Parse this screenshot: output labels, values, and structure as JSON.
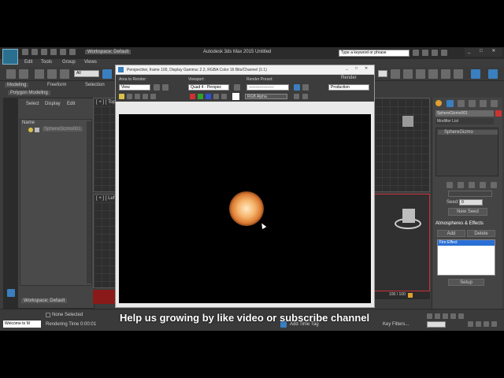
{
  "app": {
    "logo": "3ds-max-logo",
    "workspace_top": "Workspace: Default",
    "title": "Autodesk 3ds Max 2015    Untitled",
    "search_placeholder": "Type a keyword or phrase",
    "menus": [
      "Edit",
      "Tools",
      "Group",
      "Views"
    ],
    "selection_filter": "All"
  },
  "ribbon": {
    "tabs": [
      "Modeling",
      "Freeform",
      "Selection"
    ],
    "subtab": "Polygon Modeling"
  },
  "scene_explorer": {
    "tabs": [
      "Select",
      "Display",
      "Edit"
    ],
    "header": "Name",
    "items": [
      "SphereGizmo001"
    ],
    "workspace": "Workspace: Default"
  },
  "frame_window": {
    "title": "Perspective, frame 100, Display Gamma: 2.2, RGBA Color 16 Bits/Channel (1:1)",
    "area_label": "Area to Render:",
    "area_value": "View",
    "viewport_label": "Viewport:",
    "viewport_value": "Quad 4 - Perspec",
    "preset_label": "Render Preset:",
    "preset_value": "-------------------",
    "render_button": "Render",
    "render_mode": "Production",
    "channel_value": "RGB Alpha"
  },
  "command_panel": {
    "object_name": "SphereGizmo001",
    "modifier_list": "Modifier List",
    "stack_item": "SphereGizmo",
    "seed_label": "Seed:",
    "seed_value": "0",
    "new_seed_button": "New Seed",
    "rollout": "Atmospheres & Effects",
    "add_button": "Add",
    "delete_button": "Delete",
    "effects": [
      "Fire Effect"
    ],
    "setup_button": "Setup"
  },
  "viewports": {
    "top_label": "[ + ] [ Top ]",
    "left_label": "[ + ] [ Left ]"
  },
  "status": {
    "welcome": "Welcome to M",
    "selection": "None Selected",
    "render_time": "Rendering Time  0:00:01",
    "add_time_tag": "Add Time Tag",
    "frame_counter": "100 / 100",
    "key_filters": "Key Filters..."
  },
  "overlay": {
    "caption": "Help us growing by like video or subscribe channel"
  },
  "chart_data": null
}
